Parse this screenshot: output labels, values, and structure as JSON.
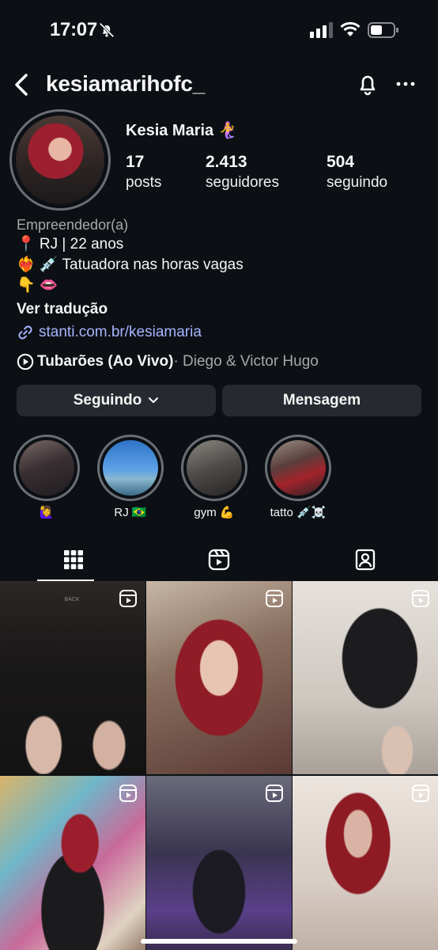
{
  "status_bar": {
    "time": "17:07",
    "icons": [
      "bell-slash-icon",
      "cellular-signal-icon",
      "wifi-icon",
      "battery-icon"
    ]
  },
  "header": {
    "username": "kesiamarihofc_",
    "icons": [
      "back-arrow-icon",
      "notification-bell-icon",
      "more-options-icon"
    ]
  },
  "profile": {
    "display_name": "Kesia Maria 🧜‍♀️",
    "stats": [
      {
        "value": "17",
        "label": "posts"
      },
      {
        "value": "2.413",
        "label": "seguidores"
      },
      {
        "value": "504",
        "label": "seguindo"
      }
    ],
    "category": "Empreendedor(a)",
    "bio_lines": [
      "📍 RJ | 22 anos",
      "❤️‍🔥 💉 Tatuadora nas horas vagas",
      "👇 👄"
    ],
    "translate_label": "Ver tradução",
    "link": "stanti.com.br/kesiamaria",
    "music": {
      "title": "Tubarões (Ao Vivo)",
      "artist": " · Diego & Victor Hugo"
    }
  },
  "buttons": {
    "following": "Seguindo",
    "message": "Mensagem"
  },
  "highlights": [
    {
      "label": "🙋‍♀️"
    },
    {
      "label": "RJ 🇧🇷"
    },
    {
      "label": "gym 💪"
    },
    {
      "label": "tatto 💉☠️"
    }
  ],
  "tabs": [
    {
      "name": "grid-tab",
      "icon": "grid-icon",
      "active": true
    },
    {
      "name": "reels-tab",
      "icon": "reels-icon",
      "active": false
    },
    {
      "name": "tagged-tab",
      "icon": "tagged-person-icon",
      "active": false
    }
  ],
  "grid_overlay_text": {
    "back_sign": "BACK"
  },
  "colors": {
    "background": "#0c1014",
    "button_bg": "#262a30",
    "link": "#a6b4ff",
    "muted_text": "#a8a8a8"
  }
}
